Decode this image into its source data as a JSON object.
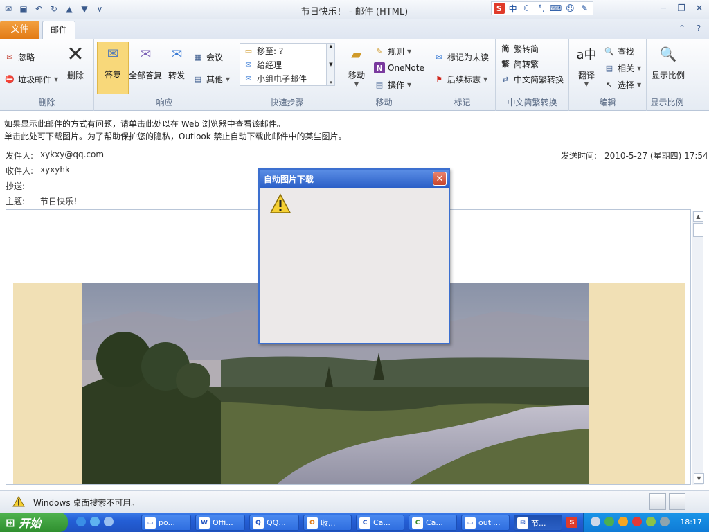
{
  "window": {
    "title": "节日快乐！ - 邮件 (HTML)"
  },
  "ribbon_tabs": {
    "file": "文件",
    "mail": "邮件"
  },
  "groups": {
    "delete": {
      "label": "删除",
      "ignore": "忽略",
      "junk": "垃圾邮件",
      "delete": "删除"
    },
    "respond": {
      "label": "响应",
      "reply": "答复",
      "reply_all": "全部答复",
      "forward": "转发",
      "meeting": "会议",
      "more": "其他"
    },
    "quicksteps": {
      "label": "快速步骤",
      "move_to": "移至: ?",
      "to_manager": "给经理",
      "team_email": "小组电子邮件"
    },
    "move": {
      "label": "移动",
      "move": "移动",
      "rules": "规则",
      "onenote": "OneNote",
      "actions": "操作"
    },
    "tags": {
      "label": "标记",
      "mark_unread": "标记为未读",
      "followup": "后续标志"
    },
    "chinese": {
      "label": "中文简繁转换",
      "to_simplified": "繁转简",
      "to_traditional": "简转繁",
      "convert": "中文简繁转换"
    },
    "editing": {
      "label": "编辑",
      "translate": "翻译",
      "find": "查找",
      "related": "相关",
      "select": "选择"
    },
    "zoom": {
      "label": "显示比例",
      "zoom": "显示比例"
    }
  },
  "infobar": {
    "line1": "如果显示此邮件的方式有问题，请单击此处以在 Web 浏览器中查看该邮件。",
    "line2": "单击此处可下载图片。为了帮助保护您的隐私，Outlook 禁止自动下载此邮件中的某些图片。"
  },
  "header": {
    "from_label": "发件人:",
    "from": "xykxy@qq.com",
    "to_label": "收件人:",
    "to": "xyxyhk",
    "cc_label": "抄送:",
    "cc": "",
    "subject_label": "主题:",
    "subject": "节日快乐！",
    "sent_label": "发送时间:",
    "sent": "2010-5-27 (星期四) 17:54"
  },
  "dialog": {
    "title": "自动图片下载"
  },
  "status": {
    "text": "Windows 桌面搜索不可用。"
  },
  "taskbar": {
    "start": "开始",
    "tasks": [
      "po...",
      "Offi...",
      "QQ...",
      "收...",
      "Ca...",
      "Ca...",
      "outl...",
      "节..."
    ],
    "clock": "18:17"
  },
  "colors": {
    "accent": "#e27b15",
    "ribbon_blue": "#3b5b8e",
    "dialog_blue": "#2b5fc7",
    "taskbar_blue": "#245fd6"
  }
}
